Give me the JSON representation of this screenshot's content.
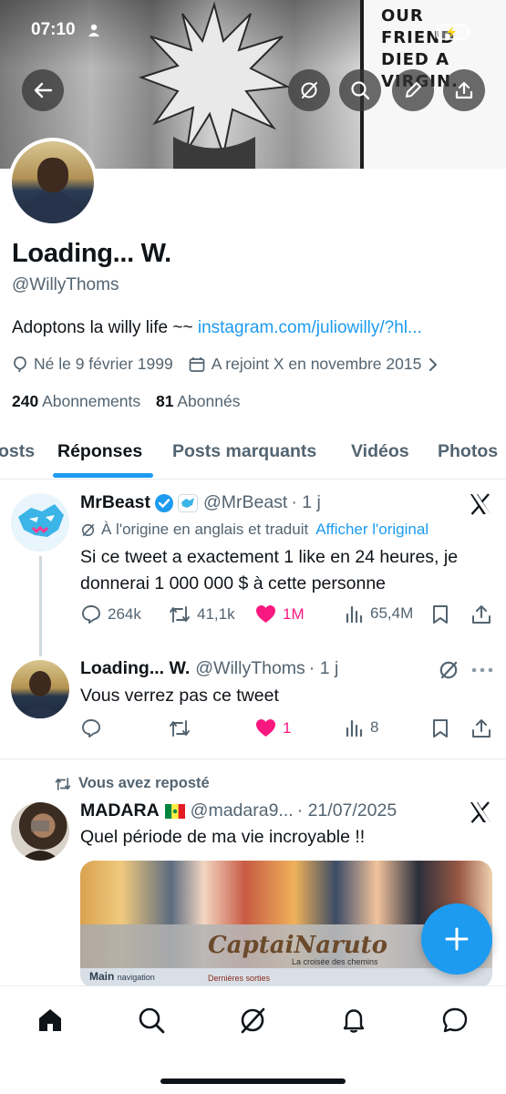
{
  "status_bar": {
    "time": "07:10"
  },
  "banner": {
    "panel_text": "OUR FRIEND DIED A VIRGIN."
  },
  "profile": {
    "display_name": "Loading... W.",
    "handle": "@WillyThoms",
    "bio_text": "Adoptons la willy life ~~ ",
    "bio_link": "instagram.com/juliowilly/?hl...",
    "birth": "Né le 9 février 1999",
    "joined": "A rejoint X en novembre 2015",
    "following_count": "240",
    "following_label": "Abonnements",
    "followers_count": "81",
    "followers_label": "Abonnés"
  },
  "tabs": [
    {
      "label": "osts"
    },
    {
      "label": "Réponses"
    },
    {
      "label": "Posts marquants"
    },
    {
      "label": "Vidéos"
    },
    {
      "label": "Photos"
    }
  ],
  "tweets": [
    {
      "name": "MrBeast",
      "handle": "@MrBeast",
      "time": "· 1 j",
      "translated_label": "À l'origine en anglais et traduit",
      "show_original": "Afficher l'original",
      "text": "Si ce tweet a exactement 1 like en 24 heures, je donnerai 1 000 000 $ à cette personne",
      "replies": "264k",
      "reposts": "41,1k",
      "likes": "1M",
      "views": "65,4M"
    },
    {
      "name": "Loading... W.",
      "handle": "@WillyThoms",
      "time": "· 1 j",
      "text": "Vous verrez pas ce tweet",
      "replies": "",
      "reposts": "",
      "likes": "1",
      "views": "8"
    },
    {
      "repost_label": "Vous avez reposté",
      "name": "MADARA",
      "handle": "@madara9...",
      "time": "· 21/07/2025",
      "text": "Quel période de ma vie incroyable !!",
      "media_logo": "CaptaiNaruto",
      "media_sub": "La croisée des chemins",
      "media_nav": "Main",
      "media_nav_sub": "navigation",
      "media_section": "Dernières sorties"
    }
  ],
  "icons": [
    "back-arrow-icon",
    "grok-icon",
    "search-icon",
    "edit-icon",
    "share-icon",
    "balloon-icon",
    "calendar-icon",
    "chevron-right-icon",
    "reply-icon",
    "repost-icon",
    "heart-icon",
    "views-icon",
    "bookmark-icon",
    "x-logo-icon",
    "more-icon",
    "plus-icon",
    "home-icon",
    "notifications-icon",
    "messages-icon"
  ],
  "colors": {
    "accent": "#1d9bf0",
    "like": "#f91880",
    "muted": "#536471"
  }
}
